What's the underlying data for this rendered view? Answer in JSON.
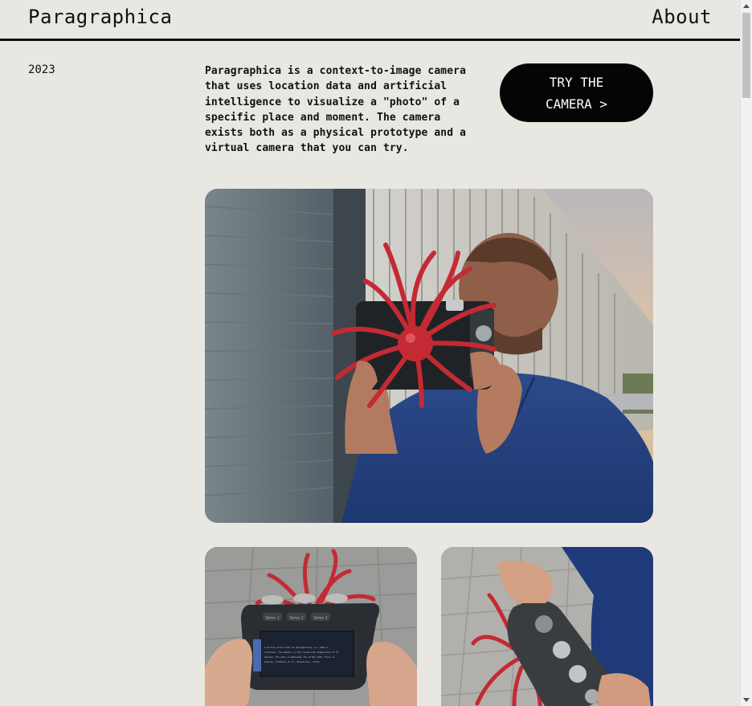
{
  "header": {
    "logo": "Paragraphica",
    "about_label": "About"
  },
  "intro": {
    "year": "2023",
    "description": "Paragraphica is a context-to-image camera that uses location data and artificial intelligence to visualize a \"photo\" of a specific place and moment. The camera exists both as a physical prototype and a virtual camera that you can try.",
    "cta_label": "TRY THE CAMERA >"
  },
  "colors": {
    "background": "#e9e7e1",
    "text": "#111111",
    "button_bg": "#050505",
    "button_text": "#ffffff",
    "camera_red": "#c42a33"
  },
  "images": [
    {
      "name": "man-holding-red-camera-photo"
    },
    {
      "name": "camera-back-screen-photo"
    },
    {
      "name": "camera-side-controls-photo"
    }
  ],
  "camera_screen": {
    "buttons": [
      "Sense 1",
      "Sense 2",
      "Sense 3"
    ],
    "text_lines": [
      "A melting clock tower at Rosengardsvej a.s. 1420 on",
      "countless. The weather is Few clouds with temperature of 18",
      "degrees. The date is Wednesday the 24 May 2023. There is",
      "Fashion, Flatbush, Hi-Fi, Restaurant, Coffee"
    ]
  }
}
